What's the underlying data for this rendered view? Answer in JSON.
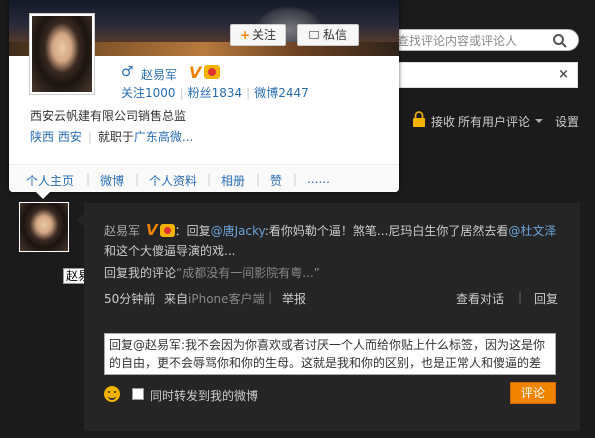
{
  "search": {
    "placeholder": "查找评论内容或评论人"
  },
  "notice_bar": {
    "close": "×"
  },
  "toolbar": {
    "receive_label": "接收",
    "receive_value": "所有用户评论",
    "settings": "设置"
  },
  "profile_card": {
    "follow_plus": "+",
    "follow_label": "关注",
    "message_label": "私信",
    "gender": "♂",
    "name": "赵易军",
    "verified": "V",
    "stats": [
      {
        "label": "关注",
        "value": "1000"
      },
      {
        "label": "粉丝",
        "value": "1834"
      },
      {
        "label": "微博",
        "value": "2447"
      }
    ],
    "description": "西安云帆建有限公司销售总监",
    "location": "陕西 西安",
    "work_prefix": "就职于",
    "company": "广东高微...",
    "tabs": [
      "个人主页",
      "微博",
      "个人资料",
      "相册",
      "赞",
      "......"
    ]
  },
  "tooltip": {
    "text": "赵易军"
  },
  "comment": {
    "author": "赵易军",
    "verified": "V",
    "body_prefix": "：回复",
    "mention1": "@唐Jacky",
    "body_mid": ":看你妈勒个逼！煞笔...尼玛白生你了居然去看",
    "mention2": "@杜文泽",
    "body_end": " 和这个大傻逼导演的戏...",
    "reply_prefix": "回复我的评论",
    "reply_quote": "“成都没有一间影院有粤...”",
    "time": "50分钟前",
    "from_prefix": "来自",
    "client": "iPhone客户端",
    "separator": "|",
    "report": "举报",
    "view_conversation": "查看对话",
    "reply": "回复",
    "reply_text": "回复@赵易军:我不会因为你喜欢或者讨厌一个人而给你贴上什么标签，因为这是你的自由，更不会辱骂你和你的生母。这就是我和你的区别，也是正常人和傻逼的差距。",
    "forward_label": "同时转发到我的微博",
    "submit": "评论"
  }
}
